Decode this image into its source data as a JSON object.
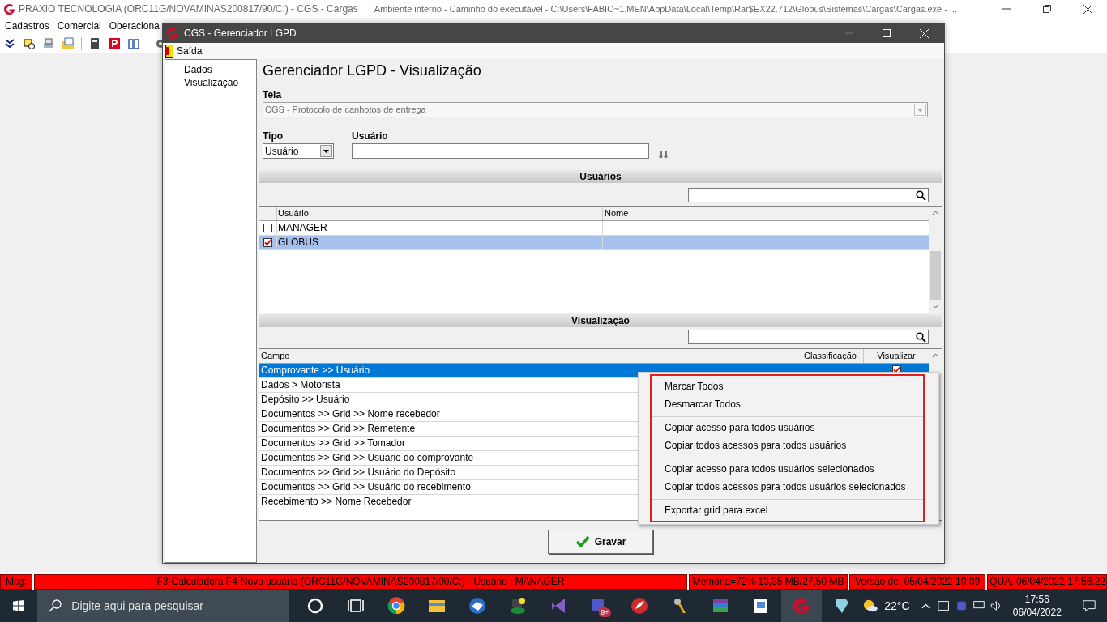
{
  "app": {
    "title": "PRAXIO TECNOLOGIA (ORC11G/NOVAMINAS200817/90/C:) - CGS - Cargas",
    "path": "Ambiente interno - Caminho do executável - C:\\Users\\FABIO~1.MEN\\AppData\\Local\\Temp\\Rar$EX22.712\\Globus\\Sistemas\\Cargas\\Cargas.exe - ..."
  },
  "menu": [
    "Cadastros",
    "Comercial",
    "Operaciona"
  ],
  "dialog": {
    "title": "CGS - Gerenciador LGPD",
    "menu": "Saída",
    "tree": [
      {
        "label": "Dados"
      },
      {
        "label": "Visualização"
      }
    ],
    "heading": "Gerenciador LGPD - Visualização",
    "tela": {
      "label": "Tela",
      "value": "CGS - Protocolo de canhotos de entrega",
      "disabled": true
    },
    "tipo": {
      "label": "Tipo",
      "value": "Usuário"
    },
    "usuario": {
      "label": "Usuário"
    },
    "usuarios": {
      "title": "Usuários",
      "columns": [
        "Usuário",
        "Nome"
      ],
      "rows": [
        {
          "user": "MANAGER",
          "checked": false,
          "selected": false
        },
        {
          "user": "GLOBUS",
          "checked": true,
          "selected": true
        }
      ]
    },
    "visualizacao": {
      "title": "Visualização",
      "columns": [
        "Campo",
        "Classificação",
        "Visualizar"
      ],
      "rows": [
        {
          "campo": "Comprovante >> Usuário",
          "visualizar": true,
          "selected": true
        },
        {
          "campo": "Dados > Motorista",
          "selected": false
        },
        {
          "campo": "Depósito >> Usuário",
          "selected": false
        },
        {
          "campo": "Documentos >> Grid >> Nome recebedor",
          "selected": false
        },
        {
          "campo": "Documentos >> Grid >> Remetente",
          "selected": false
        },
        {
          "campo": "Documentos >> Grid >> Tomador",
          "selected": false
        },
        {
          "campo": "Documentos >> Grid >> Usuário do comprovante",
          "selected": false
        },
        {
          "campo": "Documentos >> Grid >> Usuário do Depósito",
          "selected": false
        },
        {
          "campo": "Documentos >> Grid >> Usuário do recebimento",
          "selected": false
        },
        {
          "campo": "Recebimento >> Nome Recebedor",
          "selected": false
        }
      ]
    },
    "save_button": "Gravar"
  },
  "context_menu": {
    "groups": [
      [
        {
          "label": "Marcar Todos"
        },
        {
          "label": "Desmarcar Todos"
        }
      ],
      [
        {
          "label": "Copiar acesso para todos usuários"
        },
        {
          "label": "Copiar todos acessos para todos usuários"
        }
      ],
      [
        {
          "label": "Copiar acesso para todos usuários selecionados"
        },
        {
          "label": "Copiar todos acessos para todos usuários selecionados"
        }
      ],
      [
        {
          "label": "Exportar grid para excel"
        }
      ]
    ]
  },
  "status_bar": {
    "label": "Msg:",
    "message": "F3-Calculadora F4-Novo usuário (ORC11G/NOVAMINAS200817/90/C:)  - Usuário : MANAGER",
    "memory": "Memória=72% 13,35 MB/27,50 MB",
    "version": "Versão de: 05/04/2022 10:09",
    "datetime": "QUA, 06/04/2022 17:56:22"
  },
  "taskbar": {
    "search_placeholder": "Digite aqui para pesquisar",
    "badge": "9+",
    "weather": "22°C",
    "time": "17:56",
    "date": "06/04/2022"
  }
}
